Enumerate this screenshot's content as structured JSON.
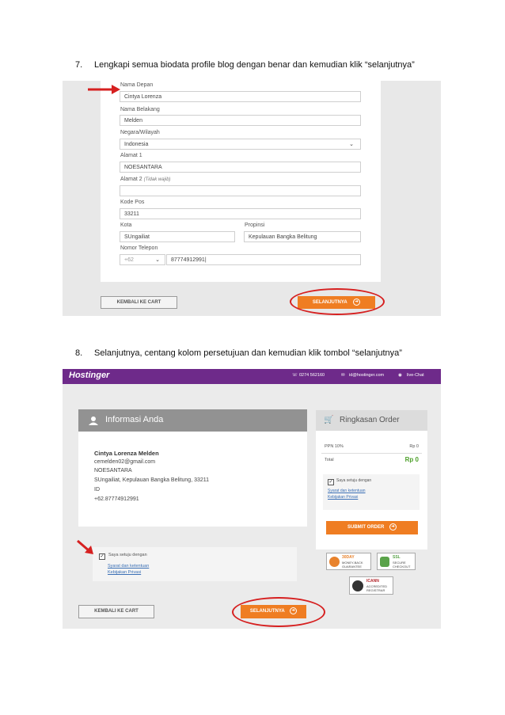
{
  "steps": [
    {
      "number": "7.",
      "text": "Lengkapi semua biodata profile blog dengan benar dan kemudian klik “selanjutnya”"
    },
    {
      "number": "8.",
      "text": "Selanjutnya, centang kolom persetujuan dan kemudian klik tombol “selanjutnya”"
    }
  ],
  "form": {
    "fields": [
      {
        "label": "Nama Depan",
        "value": "Cintya Lorenza"
      },
      {
        "label": "Nama Belakang",
        "value": "Melden"
      },
      {
        "label": "Negara/Wilayah",
        "value": "Indonesia"
      },
      {
        "label": "Alamat 1",
        "value": "NOESANTARA"
      },
      {
        "label": "Alamat 2",
        "label_note": "(Tidak wajib)",
        "value": ""
      },
      {
        "label": "Kode Pos",
        "value": "33211"
      },
      {
        "label": "Kota",
        "value": "SUngailiat"
      },
      {
        "label": "Propinsi",
        "value": "Kepulauan Bangka Belitung"
      },
      {
        "label": "Nomor Telepon",
        "code": "+62",
        "value": "87774912991|"
      }
    ],
    "back_label": "KEMBALI KE CART",
    "next_label": "SELANJUTNYA"
  },
  "checkout": {
    "logo": "Hostinger",
    "top_phone": "0274 562160",
    "top_email": "id@hostinger.com",
    "top_chat": "live-Chat",
    "info_title": "Informasi Anda",
    "info_lines": [
      "Cintya Lorenza Melden",
      "cemelden02@gmail.com",
      "NOESANTARA",
      "SUngailiat, Kepulauan Bangka Belitung, 33211",
      "ID",
      "+62.87774912991"
    ],
    "agree_text": "Saya setuju dengan",
    "terms_link": "Syarat dan ketentuan",
    "privacy_link": "Kebijakan Privasi",
    "back_label": "KEMBALI KE CART",
    "next_label": "SELANJUTNYA",
    "summary_title": "Ringkasan Order",
    "ppn_label": "PPN 10%",
    "ppn_value": "Rp 0",
    "total_label": "Total",
    "total_value": "Rp 0",
    "submit_label": "SUBMIT ORDER",
    "badges": [
      {
        "line1": "30DAY",
        "line2": "MONEY-BACK",
        "line3": "GUARANTEE"
      },
      {
        "line1": "SSL",
        "line2": "SECURE",
        "line3": "CHECKOUT"
      },
      {
        "line1": "ICANN",
        "line2": "ACCREDITED",
        "line3": "REGISTRAR"
      }
    ]
  }
}
